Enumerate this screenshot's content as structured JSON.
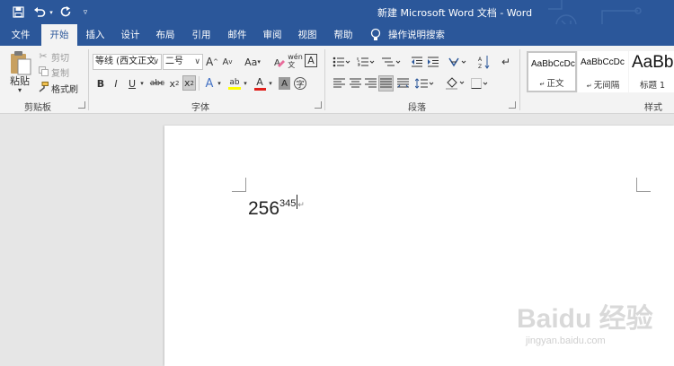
{
  "quick_access": {
    "save_icon": "save-icon",
    "undo_icon": "undo-icon",
    "redo_icon": "redo-icon",
    "customize_icon": "customize-dropdown-icon"
  },
  "window_title": "新建 Microsoft Word 文档 - Word",
  "tabs": [
    {
      "label": "文件",
      "active": false
    },
    {
      "label": "开始",
      "active": true
    },
    {
      "label": "插入",
      "active": false
    },
    {
      "label": "设计",
      "active": false
    },
    {
      "label": "布局",
      "active": false
    },
    {
      "label": "引用",
      "active": false
    },
    {
      "label": "邮件",
      "active": false
    },
    {
      "label": "审阅",
      "active": false
    },
    {
      "label": "视图",
      "active": false
    },
    {
      "label": "帮助",
      "active": false
    }
  ],
  "tell_me": "操作说明搜索",
  "clipboard": {
    "paste": "粘贴",
    "cut": "剪切",
    "copy": "复制",
    "format_painter": "格式刷",
    "label": "剪贴板"
  },
  "font": {
    "font_name": "等线 (西文正文",
    "font_size": "二号",
    "grow": "A",
    "shrink": "A",
    "case": "Aa",
    "bold": "B",
    "italic": "I",
    "underline": "U",
    "strike": "abc",
    "subscript": "x",
    "superscript": "x",
    "text_effects": "A",
    "highlight": "ab",
    "font_color": "A",
    "char_shading": "A",
    "label": "字体",
    "font_color_hex": "#e0201b",
    "highlight_hex": "#ffff00"
  },
  "paragraph": {
    "label": "段落"
  },
  "styles": {
    "items": [
      {
        "sample": "AaBbCcDc",
        "name": "正文",
        "selected": true
      },
      {
        "sample": "AaBbCcDc",
        "name": "无间隔",
        "selected": false
      },
      {
        "sample": "AaBb",
        "name": "标题 1",
        "selected": false
      }
    ],
    "label": "样式"
  },
  "document": {
    "base": "256",
    "superscript": "345"
  },
  "watermark": {
    "logo": "Baidu 经验",
    "url": "jingyan.baidu.com"
  },
  "colors": {
    "accent": "#2b579a",
    "ribbon_bg": "#f3f3f3",
    "doc_bg": "#e6e6e6"
  }
}
